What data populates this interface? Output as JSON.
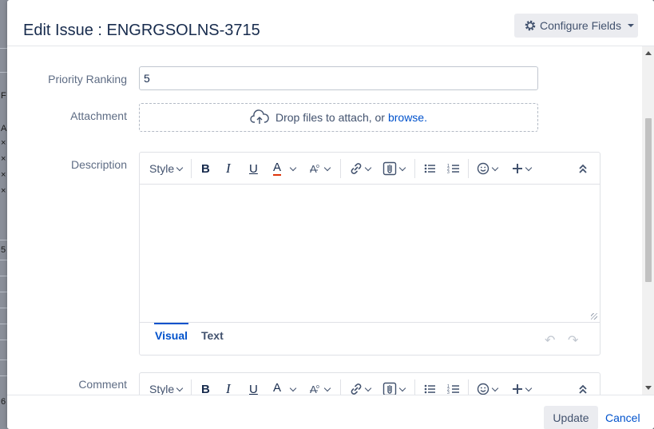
{
  "dialog": {
    "title": "Edit Issue : ENGRGSOLNS-3715",
    "configure_fields_label": "Configure Fields",
    "icons": {
      "configure": "gear-icon",
      "configure_caret": "caret-down-icon"
    }
  },
  "background": {
    "chars": [
      "F",
      "A",
      "×",
      "×",
      "×",
      "×",
      "5",
      "6"
    ]
  },
  "fields": {
    "priority_ranking": {
      "label": "Priority Ranking",
      "value": "5"
    },
    "attachment": {
      "label": "Attachment",
      "drop_text": "Drop files to attach, or",
      "browse_text": "browse.",
      "icon": "cloud-upload-icon"
    },
    "description": {
      "label": "Description"
    },
    "comment": {
      "label": "Comment"
    }
  },
  "editor": {
    "style_label": "Style",
    "bold_label": "B",
    "italic_label": "I",
    "underline_label": "U",
    "text_color_label": "A",
    "text_color": "#de350b",
    "tabs": {
      "visual": "Visual",
      "text": "Text"
    },
    "toolbar_icons": [
      "more-formatting-icon",
      "link-icon",
      "attachment-icon",
      "bullet-list-icon",
      "numbered-list-icon",
      "emoji-icon",
      "insert-more-icon",
      "collapse-toolbar-icon",
      "undo-icon",
      "redo-icon"
    ]
  },
  "footer": {
    "update_label": "Update",
    "cancel_label": "Cancel"
  },
  "colors": {
    "link": "#0052cc",
    "title": "#172b4d",
    "label": "#5e6c84",
    "button_bg": "#ebecf0"
  }
}
